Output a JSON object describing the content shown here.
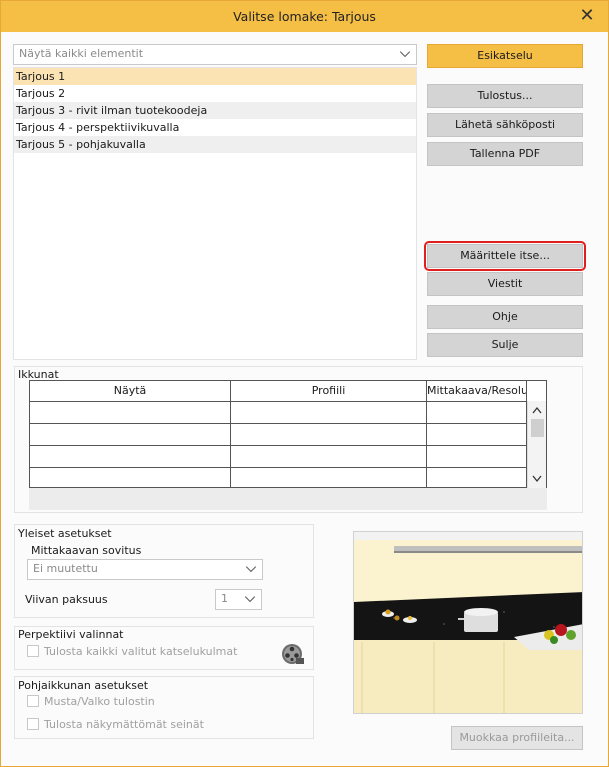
{
  "window": {
    "title": "Valitse lomake: Tarjous",
    "close_label": "✕"
  },
  "filter": {
    "selected": "Näytä kaikki elementit",
    "icon": "chevron-down-icon"
  },
  "forms": [
    {
      "label": "Tarjous 1"
    },
    {
      "label": "Tarjous 2"
    },
    {
      "label": "Tarjous 3 - rivit ilman tuotekoodeja"
    },
    {
      "label": "Tarjous 4 - perspektiivikuvalla"
    },
    {
      "label": "Tarjous 5 - pohjakuvalla"
    }
  ],
  "buttons": {
    "preview": "Esikatselu",
    "print": "Tulostus...",
    "email": "Lähetä sähköposti",
    "save_pdf": "Tallenna PDF",
    "define": "Määrittele itse...",
    "messages": "Viestit",
    "help": "Ohje",
    "close": "Sulje",
    "edit_profiles": "Muokkaa profiileita..."
  },
  "windows_section": {
    "label": "Ikkunat",
    "columns": [
      "Näytä",
      "Profiili",
      "Mittakaava/Resoluutio"
    ]
  },
  "general": {
    "label": "Yleiset asetukset",
    "scale_fit_label": "Mittakaavan sovitus",
    "scale_fit_value": "Ei muutettu",
    "line_width_label": "Viivan paksuus",
    "line_width_value": "1"
  },
  "perspective": {
    "label": "Perpektiivi valinnat",
    "print_all_label": "Tulosta kaikki valitut katselukulmat"
  },
  "floorplan": {
    "label": "Pohjaikkunan asetukset",
    "bw_label": "Musta/Valko tulostin",
    "hidden_walls_label": "Tulosta näkymättömät seinät"
  },
  "colors": {
    "accent": "#f5bf45",
    "focus": "#e0201f"
  }
}
